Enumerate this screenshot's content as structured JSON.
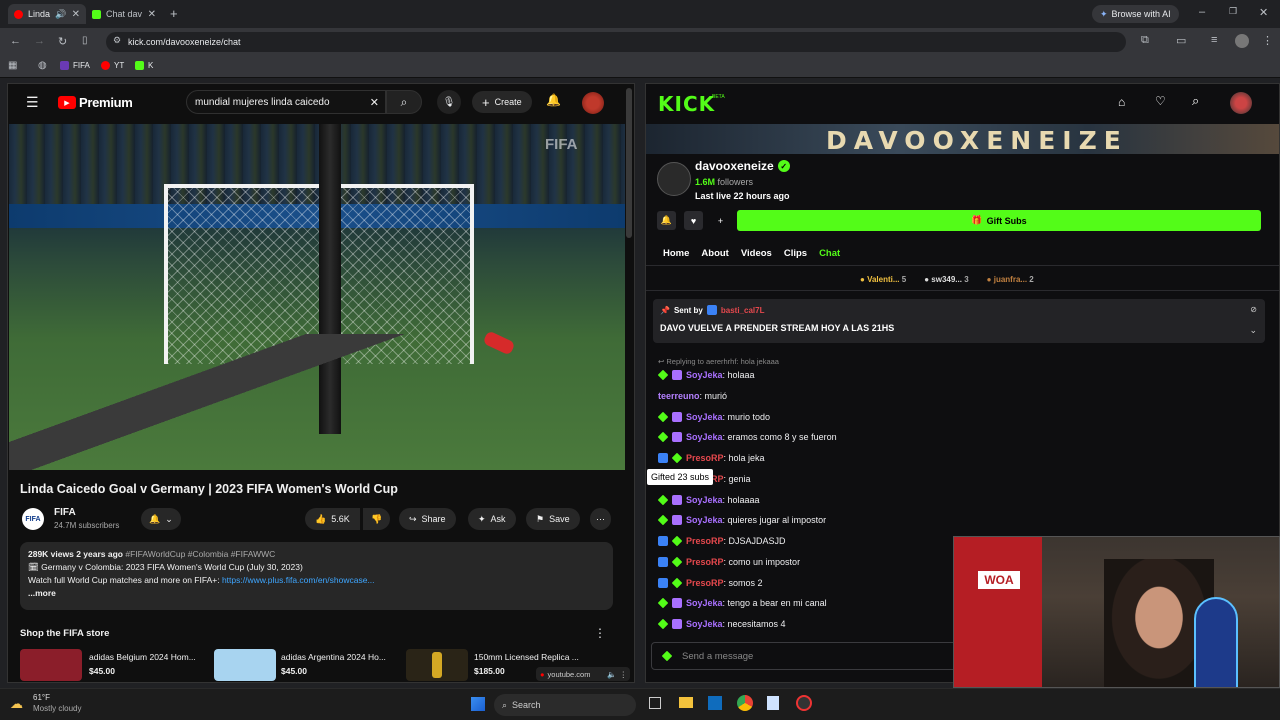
{
  "browser": {
    "tabs": [
      {
        "label": "Linda",
        "color": "#ff0000"
      },
      {
        "label": "Chat dav",
        "color": "#53fc18"
      }
    ],
    "url": "kick.com/davooxeneize/chat",
    "browse_ai": "Browse with AI",
    "bookmarks": [
      "FIFA",
      "YT",
      "K"
    ]
  },
  "youtube": {
    "brand": "Premium",
    "search_value": "mundial mujeres linda caicedo",
    "create_label": "Create",
    "video_watermark": "FIFA",
    "video_title": "Linda Caicedo Goal v Germany | 2023 FIFA Women's World Cup",
    "channel_name": "FIFA",
    "subscribers": "24.7M subscribers",
    "likes": "5.6K",
    "share_label": "Share",
    "ask_label": "Ask",
    "save_label": "Save",
    "desc_meta": "289K views  2 years ago",
    "desc_tags": "#FIFAWorldCup #Colombia #FIFAWWC",
    "desc_line1": "Germany v Colombia: 2023 FIFA Women's World Cup (July 30, 2023)",
    "desc_line2_prefix": "Watch full World Cup matches and more on FIFA+: ",
    "desc_link": "https://www.plus.fifa.com/en/showcase...",
    "desc_more": "...more",
    "shop_title": "Shop the FIFA store",
    "products": [
      {
        "name": "adidas Belgium 2024 Hom...",
        "price": "$45.00"
      },
      {
        "name": "adidas Argentina 2024 Ho...",
        "price": "$45.00"
      },
      {
        "name": "150mm Licensed Replica ...",
        "price": "$185.00"
      }
    ],
    "mini_player_label": "youtube.com"
  },
  "kick": {
    "logo": "KICK",
    "logo_tag": "BETA",
    "banner_text": "DAVOOXENEIZE",
    "channel_name": "davooxeneize",
    "followers_count": "1.6M",
    "followers_label": "followers",
    "last_live": "Last live 22 hours ago",
    "gift_subs": "Gift Subs",
    "nav": [
      "Home",
      "About",
      "Videos",
      "Clips",
      "Chat"
    ],
    "leaderboard": [
      {
        "name": "Valenti...",
        "count": "5"
      },
      {
        "name": "sw349...",
        "count": "3"
      },
      {
        "name": "juanfra...",
        "count": "2"
      }
    ],
    "pinned_sent_by": "Sent by",
    "pinned_user": "basti_cal7L",
    "pinned_message": "DAVO VUELVE A PRENDER STREAM HOY A LAS 21HS",
    "reply_context": "Replying to aererhrhf: hola jekaaa",
    "tooltip": "Gifted 23 subs",
    "messages": [
      {
        "user": "SoyJeka",
        "text": ": holaaa",
        "style": "purple",
        "badges": [
          "green",
          "purple"
        ]
      },
      {
        "user": "teerreuno",
        "text": ": murió",
        "style": "violet",
        "badges": []
      },
      {
        "user": "SoyJeka",
        "text": ": murio todo",
        "style": "purple",
        "badges": [
          "green",
          "purple"
        ]
      },
      {
        "user": "SoyJeka",
        "text": ": eramos como 8 y se fueron",
        "style": "purple",
        "badges": [
          "green",
          "purple"
        ]
      },
      {
        "user": "PresoRP",
        "text": ": hola jeka",
        "style": "red",
        "badges": [
          "blue",
          "green"
        ]
      },
      {
        "user": "PresoRP",
        "text": ": genia",
        "style": "red",
        "badges": [
          "blue",
          "green"
        ]
      },
      {
        "user": "SoyJeka",
        "text": ": holaaaa",
        "style": "purple",
        "badges": [
          "green",
          "purple"
        ]
      },
      {
        "user": "SoyJeka",
        "text": ": quieres jugar al impostor",
        "style": "purple",
        "badges": [
          "green",
          "purple"
        ]
      },
      {
        "user": "PresoRP",
        "text": ": DJSAJDASJD",
        "style": "red",
        "badges": [
          "blue",
          "green"
        ]
      },
      {
        "user": "PresoRP",
        "text": ": como un impostor",
        "style": "red",
        "badges": [
          "blue",
          "green"
        ]
      },
      {
        "user": "PresoRP",
        "text": ": somos 2",
        "style": "red",
        "badges": [
          "blue",
          "green"
        ]
      },
      {
        "user": "SoyJeka",
        "text": ": tengo a bear en mi canal",
        "style": "purple",
        "badges": [
          "green",
          "purple"
        ]
      },
      {
        "user": "SoyJeka",
        "text": ": necesitamos 4",
        "style": "purple",
        "badges": [
          "green",
          "purple"
        ]
      }
    ],
    "chat_placeholder": "Send a message",
    "accent": "#53fc18"
  },
  "taskbar": {
    "weather_temp": "61°F",
    "weather_desc": "Mostly cloudy",
    "search_label": "Search"
  }
}
